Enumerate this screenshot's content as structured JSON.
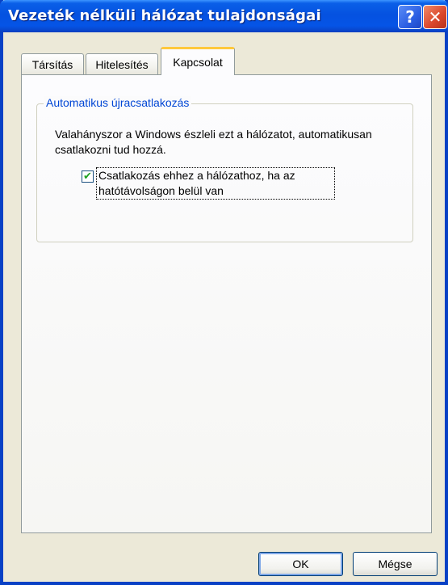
{
  "window": {
    "title": "Vezeték nélküli hálózat tulajdonságai",
    "help_glyph": "?",
    "close_glyph": "✕"
  },
  "tabs": [
    {
      "label": "Társítás",
      "selected": false
    },
    {
      "label": "Hitelesítés",
      "selected": false
    },
    {
      "label": "Kapcsolat",
      "selected": true
    }
  ],
  "group": {
    "title": "Automatikus újracsatlakozás",
    "description": "Valahányszor a Windows észleli ezt a hálózatot, automatikusan csatlakozni tud hozzá.",
    "checkbox": {
      "label": "Csatlakozás ehhez a hálózathoz, ha az hatótávolságon belül van",
      "checked": true,
      "check_glyph": "✔"
    }
  },
  "buttons": {
    "ok": "OK",
    "cancel": "Mégse"
  },
  "colors": {
    "titlebar": "#0554e6",
    "window_border": "#0841c5",
    "group_title": "#0046d5",
    "selected_tab_accent": "#ffc83c",
    "checkmark": "#21a121",
    "dialog_bg": "#ece9d8"
  }
}
